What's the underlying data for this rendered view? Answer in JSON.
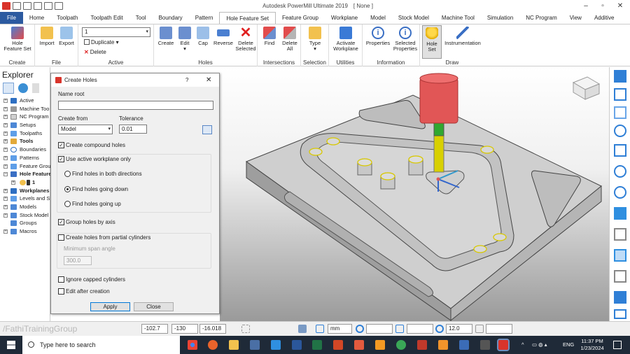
{
  "window": {
    "title": "Autodesk PowerMill Ultimate 2019",
    "doc": "[ None ]"
  },
  "tabs": [
    "File",
    "Home",
    "Toolpath",
    "Toolpath Edit",
    "Tool",
    "Boundary",
    "Pattern",
    "Hole Feature Set",
    "Feature Group",
    "Workplane",
    "Model",
    "Stock Model",
    "Machine Tool",
    "Simulation",
    "NC Program",
    "View",
    "Additive"
  ],
  "active_tab": "Hole Feature Set",
  "ribbon": {
    "create": {
      "label": "Create",
      "btn": "Hole Feature Set"
    },
    "file": {
      "label": "File",
      "import": "Import",
      "export": "Export"
    },
    "active": {
      "label": "Active",
      "select_value": "1",
      "duplicate": "Duplicate",
      "delete": "Delete"
    },
    "holes": {
      "label": "Holes",
      "create": "Create",
      "edit": "Edit",
      "cap": "Cap",
      "reverse": "Reverse",
      "delete_selected": "Delete Selected"
    },
    "intersections": {
      "label": "Intersections",
      "find": "Find",
      "delete_all": "Delete All"
    },
    "selection": {
      "label": "Selection",
      "type": "Type"
    },
    "utilities": {
      "label": "Utilities",
      "activate_workplane": "Activate Workplane"
    },
    "information": {
      "label": "Information",
      "properties": "Properties",
      "selected_properties": "Selected Properties"
    },
    "draw": {
      "label": "Draw",
      "hole_set": "Hole Set",
      "instrumentation": "Instrumentation"
    }
  },
  "explorer": {
    "title": "Explorer",
    "items": [
      {
        "label": "Active",
        "bold": false
      },
      {
        "label": "Machine Too",
        "bold": false
      },
      {
        "label": "NC Program",
        "bold": false
      },
      {
        "label": "Setups",
        "bold": false
      },
      {
        "label": "Toolpaths",
        "bold": false
      },
      {
        "label": "Tools",
        "bold": true
      },
      {
        "label": "Boundaries",
        "bold": false
      },
      {
        "label": "Patterns",
        "bold": false
      },
      {
        "label": "Feature Grou",
        "bold": false
      },
      {
        "label": "Hole Feature",
        "bold": true
      },
      {
        "label": "1",
        "bold": true
      },
      {
        "label": "Workplanes",
        "bold": true
      },
      {
        "label": "Levels and S",
        "bold": false
      },
      {
        "label": "Models",
        "bold": false
      },
      {
        "label": "Stock Model",
        "bold": false
      },
      {
        "label": "Groups",
        "bold": false
      },
      {
        "label": "Macros",
        "bold": false
      }
    ]
  },
  "dialog": {
    "title": "Create Holes",
    "help": "?",
    "close": "✕",
    "name_root_label": "Name root",
    "name_root_value": "",
    "create_from_label": "Create from",
    "create_from_value": "Model",
    "tolerance_label": "Tolerance",
    "tolerance_value": "0.01",
    "create_compound": "Create compound holes",
    "use_active_wp": "Use active workplane only",
    "radio_both": "Find holes in both directions",
    "radio_down": "Find holes going down",
    "radio_up": "Find holes going up",
    "group_by_axis": "Group holes by axis",
    "partial_cyl": "Create holes from partial cylinders",
    "min_span_label": "Minimum span angle",
    "min_span_value": "300.0",
    "ignore_capped": "Ignore capped cylinders",
    "edit_after": "Edit after creation",
    "apply": "Apply",
    "close_btn": "Close"
  },
  "status": {
    "watermark": "/FathiTrainingGroup",
    "x": "-102.7",
    "y": "-130",
    "z": "-16.018",
    "units": "mm",
    "diam": "12.0"
  },
  "taskbar": {
    "search": "Type here to search",
    "time": "11:37 PM",
    "date": "1/23/2024",
    "lang": "ENG"
  },
  "colors": {
    "file_tab": "#2c5aa0",
    "accent": "#0078d7",
    "tool_head": "#e15656",
    "taskbar": "#1f2a38",
    "part": "#c9c9c9"
  }
}
